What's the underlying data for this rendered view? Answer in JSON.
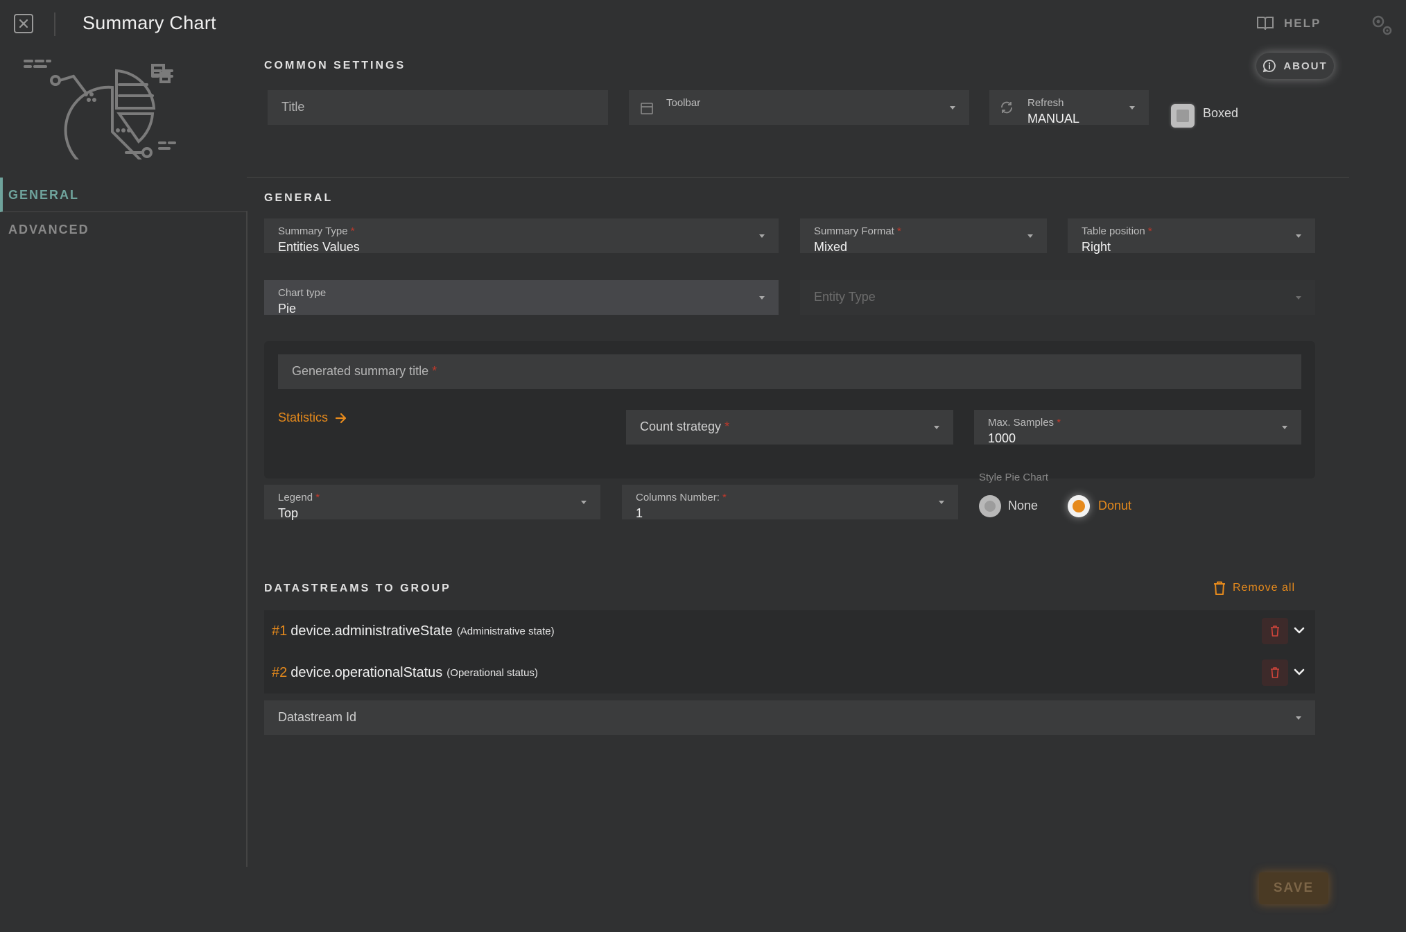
{
  "header": {
    "title": "Summary Chart",
    "help_label": "HELP"
  },
  "sidebar": {
    "items": [
      {
        "label": "GENERAL",
        "active": true
      },
      {
        "label": "ADVANCED",
        "active": false
      }
    ]
  },
  "common_settings": {
    "section_title": "COMMON SETTINGS",
    "about_label": "ABOUT",
    "title_placeholder": "Title",
    "toolbar_label": "Toolbar",
    "toolbar_value": "",
    "refresh_label": "Refresh",
    "refresh_value": "MANUAL",
    "boxed_label": "Boxed",
    "boxed_checked": false
  },
  "general": {
    "section_title": "GENERAL",
    "summary_type": {
      "label": "Summary Type",
      "value": "Entities Values"
    },
    "summary_format": {
      "label": "Summary Format",
      "value": "Mixed"
    },
    "table_position": {
      "label": "Table position",
      "value": "Right"
    },
    "chart_type": {
      "label": "Chart type",
      "value": "Pie"
    },
    "entity_type": {
      "placeholder": "Entity Type"
    },
    "generated_title": {
      "placeholder": "Generated summary title"
    },
    "statistics_link": "Statistics",
    "count_strategy": {
      "placeholder": "Count strategy"
    },
    "max_samples": {
      "label": "Max. Samples",
      "value": "1000"
    },
    "legend": {
      "label": "Legend",
      "value": "Top"
    },
    "columns_number": {
      "label": "Columns Number:",
      "value": "1"
    },
    "style_pie_chart": {
      "label": "Style Pie Chart",
      "options": [
        {
          "label": "None",
          "selected": false
        },
        {
          "label": "Donut",
          "selected": true
        }
      ]
    }
  },
  "datastreams": {
    "section_title": "DATASTREAMS TO GROUP",
    "remove_all_label": "Remove all",
    "items": [
      {
        "num": "#1",
        "name": "device.administrativeState",
        "desc": "(Administrative state)"
      },
      {
        "num": "#2",
        "name": "device.operationalStatus",
        "desc": "(Operational status)"
      }
    ],
    "datastream_id_placeholder": "Datastream Id"
  },
  "footer": {
    "save_label": "SAVE"
  },
  "colors": {
    "background": "#303132",
    "accent": "#e68a1c",
    "sidebar_active": "#6fa39c",
    "field_bg": "#3b3c3d",
    "required": "#c0392b"
  }
}
